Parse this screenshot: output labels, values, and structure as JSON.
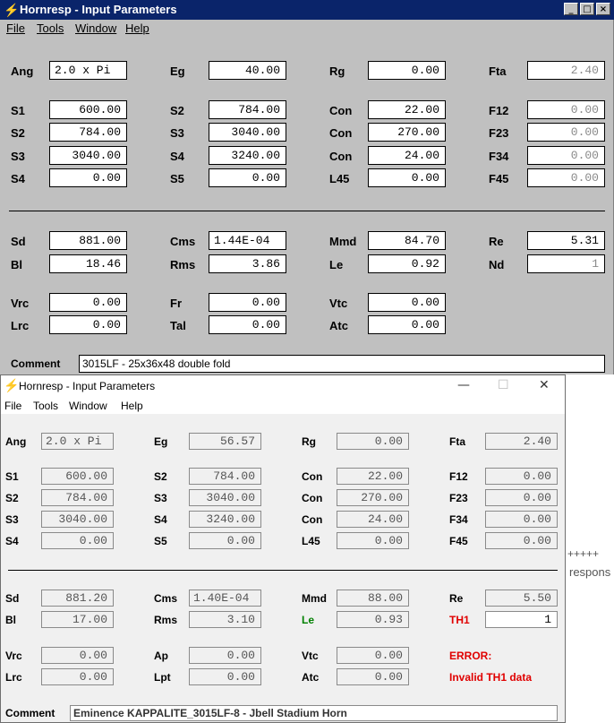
{
  "window1": {
    "title": "Hornresp - Input Parameters",
    "controls": [
      "_",
      "□",
      "×"
    ],
    "menu": [
      "File",
      "Tools",
      "Window",
      "Help"
    ],
    "rows": {
      "r1": [
        [
          "Ang",
          "2.0 x Pi"
        ],
        [
          "Eg",
          "40.00"
        ],
        [
          "Rg",
          "0.00"
        ],
        [
          "Fta",
          "2.40"
        ]
      ],
      "r2": [
        [
          "S1",
          "600.00"
        ],
        [
          "S2",
          "784.00"
        ],
        [
          "Con",
          "22.00"
        ],
        [
          "F12",
          "0.00"
        ]
      ],
      "r3": [
        [
          "S2",
          "784.00"
        ],
        [
          "S3",
          "3040.00"
        ],
        [
          "Con",
          "270.00"
        ],
        [
          "F23",
          "0.00"
        ]
      ],
      "r4": [
        [
          "S3",
          "3040.00"
        ],
        [
          "S4",
          "3240.00"
        ],
        [
          "Con",
          "24.00"
        ],
        [
          "F34",
          "0.00"
        ]
      ],
      "r5": [
        [
          "S4",
          "0.00"
        ],
        [
          "S5",
          "0.00"
        ],
        [
          "L45",
          "0.00"
        ],
        [
          "F45",
          "0.00"
        ]
      ],
      "r6": [
        [
          "Sd",
          "881.00"
        ],
        [
          "Cms",
          "1.44E-04"
        ],
        [
          "Mmd",
          "84.70"
        ],
        [
          "Re",
          "5.31"
        ]
      ],
      "r7": [
        [
          "Bl",
          "18.46"
        ],
        [
          "Rms",
          "3.86"
        ],
        [
          "Le",
          "0.92"
        ],
        [
          "Nd",
          "1"
        ]
      ],
      "r8": [
        [
          "Vrc",
          "0.00"
        ],
        [
          "Fr",
          "0.00"
        ],
        [
          "Vtc",
          "0.00"
        ]
      ],
      "r9": [
        [
          "Lrc",
          "0.00"
        ],
        [
          "Tal",
          "0.00"
        ],
        [
          "Atc",
          "0.00"
        ]
      ]
    },
    "comment_label": "Comment",
    "comment": "3015LF - 25x36x48 double fold"
  },
  "window2": {
    "title": "Hornresp - Input Parameters",
    "controls": [
      "—",
      "☐",
      "✕"
    ],
    "menu": [
      "File",
      "Tools",
      "Window",
      "Help"
    ],
    "rows": {
      "r1": [
        [
          "Ang",
          "2.0 x Pi"
        ],
        [
          "Eg",
          "56.57"
        ],
        [
          "Rg",
          "0.00"
        ],
        [
          "Fta",
          "2.40"
        ]
      ],
      "r2": [
        [
          "S1",
          "600.00"
        ],
        [
          "S2",
          "784.00"
        ],
        [
          "Con",
          "22.00"
        ],
        [
          "F12",
          "0.00"
        ]
      ],
      "r3": [
        [
          "S2",
          "784.00"
        ],
        [
          "S3",
          "3040.00"
        ],
        [
          "Con",
          "270.00"
        ],
        [
          "F23",
          "0.00"
        ]
      ],
      "r4": [
        [
          "S3",
          "3040.00"
        ],
        [
          "S4",
          "3240.00"
        ],
        [
          "Con",
          "24.00"
        ],
        [
          "F34",
          "0.00"
        ]
      ],
      "r5": [
        [
          "S4",
          "0.00"
        ],
        [
          "S5",
          "0.00"
        ],
        [
          "L45",
          "0.00"
        ],
        [
          "F45",
          "0.00"
        ]
      ],
      "r6": [
        [
          "Sd",
          "881.20"
        ],
        [
          "Cms",
          "1.40E-04"
        ],
        [
          "Mmd",
          "88.00"
        ],
        [
          "Re",
          "5.50"
        ]
      ],
      "r7": [
        [
          "Bl",
          "17.00"
        ],
        [
          "Rms",
          "3.10"
        ],
        [
          "Le",
          "0.93"
        ],
        [
          "TH1",
          "1"
        ]
      ],
      "r8": [
        [
          "Vrc",
          "0.00"
        ],
        [
          "Ap",
          "0.00"
        ],
        [
          "Vtc",
          "0.00"
        ]
      ],
      "r9": [
        [
          "Lrc",
          "0.00"
        ],
        [
          "Lpt",
          "0.00"
        ],
        [
          "Atc",
          "0.00"
        ]
      ]
    },
    "error_label": "ERROR:",
    "error_message": "Invalid TH1 data",
    "comment_label": "Comment",
    "comment": "Eminence KAPPALITE_3015LF-8 - Jbell Stadium Horn"
  },
  "background": {
    "plus_text": "+++++",
    "respons_text": "respons"
  },
  "colors": {
    "classic_titlebar": "#0a246a",
    "classic_face": "#c0c0c0",
    "modern_face": "#f0f0f0",
    "label_highlight_green": "#008000",
    "error_red": "#e00000"
  }
}
